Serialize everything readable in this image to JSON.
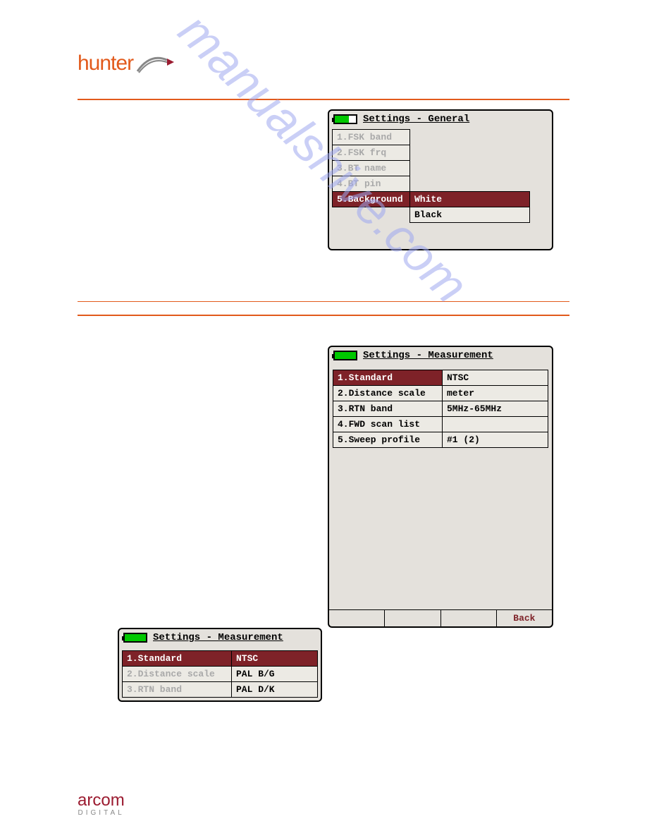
{
  "logo": {
    "top_text": "hunter",
    "bottom_brand": "arcom",
    "bottom_sub": "DIGITAL"
  },
  "watermark": "manualshive.com",
  "screen1": {
    "title": "Settings - General",
    "rows": [
      {
        "label": "1.FSK band",
        "dim": true
      },
      {
        "label": "2.FSK frq",
        "dim": true
      },
      {
        "label": "3.BT name",
        "dim": true
      },
      {
        "label": "4.BT pin",
        "dim": true
      },
      {
        "label": "5.Background",
        "value": "White",
        "selected": true
      },
      {
        "label": "",
        "value": "Black"
      }
    ]
  },
  "screen2": {
    "title": "Settings - Measurement",
    "rows": [
      {
        "label": "1.Standard",
        "value": "NTSC",
        "selected": true
      },
      {
        "label": "2.Distance scale",
        "value": "meter"
      },
      {
        "label": "3.RTN band",
        "value": "5MHz-65MHz"
      },
      {
        "label": "4.FWD scan list",
        "value": ""
      },
      {
        "label": "5.Sweep profile",
        "value": "#1 (2)"
      }
    ],
    "footer": [
      "",
      "",
      "",
      "Back"
    ]
  },
  "screen3": {
    "title": "Settings - Measurement",
    "rows": [
      {
        "label": "1.Standard",
        "value": "NTSC",
        "selected": true
      },
      {
        "label": "2.Distance scale",
        "value": "PAL B/G",
        "dim": true
      },
      {
        "label": "3.RTN band",
        "value": "PAL D/K",
        "dim": true
      }
    ]
  }
}
